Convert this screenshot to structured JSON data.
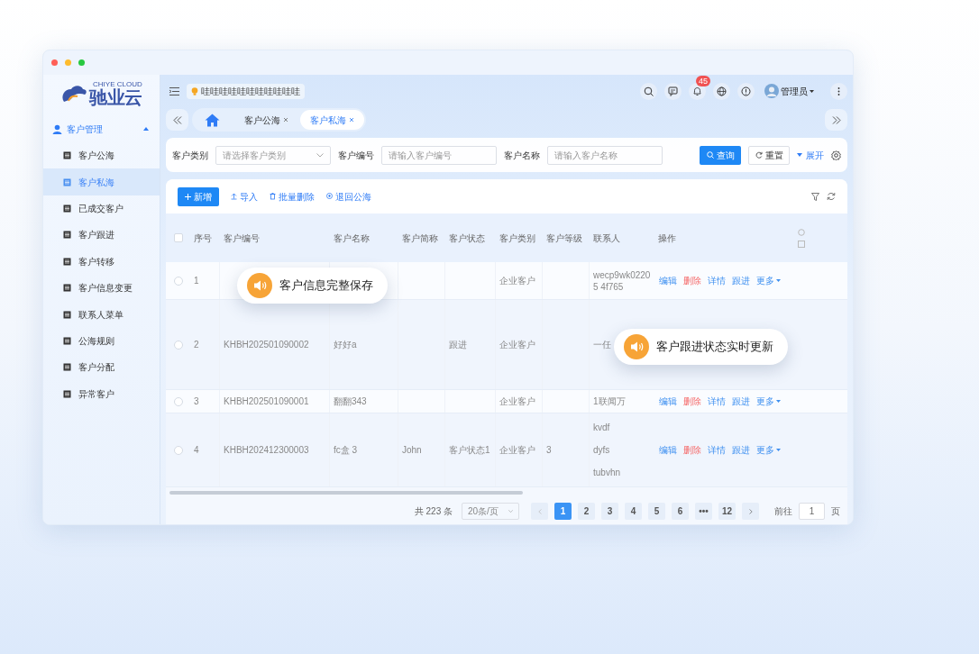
{
  "sidebar": {
    "logo": "驰业云",
    "logo_sub": "CHIYE CLOUD",
    "group": {
      "label": "客户管理",
      "expanded": true,
      "items": [
        {
          "label": "客户公海",
          "selected": false
        },
        {
          "label": "客户私海",
          "selected": true
        },
        {
          "label": "已成交客户",
          "selected": false
        },
        {
          "label": "客户跟进",
          "selected": false
        },
        {
          "label": "客户转移",
          "selected": false
        },
        {
          "label": "客户信息变更",
          "selected": false
        },
        {
          "label": "联系人菜单",
          "selected": false
        },
        {
          "label": "公海规则",
          "selected": false
        },
        {
          "label": "客户分配",
          "selected": false
        },
        {
          "label": "异常客户",
          "selected": false
        }
      ]
    }
  },
  "header": {
    "notice": "哇哇哇哇哇哇哇哇哇哇哇",
    "badge": "45",
    "user": "管理员"
  },
  "tabs": [
    {
      "label": "客户公海",
      "selected": false
    },
    {
      "label": "客户私海",
      "selected": true
    }
  ],
  "filters": [
    {
      "label": "客户类别",
      "kind": "select",
      "placeholder": "请选择客户类别"
    },
    {
      "label": "客户编号",
      "kind": "input",
      "placeholder": "请输入客户编号"
    },
    {
      "label": "客户名称",
      "kind": "input",
      "placeholder": "请输入客户名称"
    }
  ],
  "filter_buttons": {
    "query": "查询",
    "reset": "重置",
    "expand": "展开"
  },
  "toolbar": {
    "add": "新增",
    "actions": [
      "导入",
      "批量删除",
      "退回公海"
    ]
  },
  "table": {
    "all_checked": false,
    "columns": [
      "序号",
      "客户编号",
      "客户名称",
      "客户简称",
      "客户状态",
      "客户类别",
      "客户等级",
      "联系人",
      "操作"
    ],
    "rows": [
      {
        "checked": false,
        "cells": [
          "1",
          "",
          "",
          "",
          "",
          "企业客户",
          ""
        ],
        "contacts": [
          "wecp9wk02205 4f765"
        ],
        "actions": [
          {
            "label": "编辑",
            "kind": "link"
          },
          {
            "label": "删除",
            "kind": "danger"
          },
          {
            "label": "详情",
            "kind": "link"
          },
          {
            "label": "跟进",
            "kind": "link"
          },
          {
            "label": "更多",
            "kind": "more"
          }
        ]
      },
      {
        "checked": false,
        "cells": [
          "2",
          "KHBH202501090002",
          "好好a",
          "",
          "跟进",
          "企业客户",
          ""
        ],
        "contacts": [
          "一任"
        ],
        "actions": []
      },
      {
        "checked": false,
        "cells": [
          "3",
          "KHBH202501090001",
          "翻翻343",
          "",
          "",
          "企业客户",
          ""
        ],
        "contacts": [
          "1联闻万"
        ],
        "actions": [
          {
            "label": "编辑",
            "kind": "link"
          },
          {
            "label": "删除",
            "kind": "danger"
          },
          {
            "label": "详情",
            "kind": "link"
          },
          {
            "label": "跟进",
            "kind": "link"
          },
          {
            "label": "更多",
            "kind": "more"
          }
        ]
      },
      {
        "checked": false,
        "cells": [
          "4",
          "KHBH202412300003",
          "fc盒 3",
          "John",
          "客户状态1",
          "企业客户",
          "3"
        ],
        "contacts": [
          "kvdf",
          "dyfs",
          "tubvhn"
        ],
        "actions": [
          {
            "label": "编辑",
            "kind": "link"
          },
          {
            "label": "删除",
            "kind": "danger"
          },
          {
            "label": "详情",
            "kind": "link"
          },
          {
            "label": "跟进",
            "kind": "link"
          },
          {
            "label": "更多",
            "kind": "more"
          }
        ]
      }
    ]
  },
  "pagination": {
    "total": "共 223 条",
    "size": "20条/页",
    "pages": [
      {
        "label": "1",
        "selected": true
      },
      {
        "label": "2",
        "selected": false
      },
      {
        "label": "3",
        "selected": false
      },
      {
        "label": "4",
        "selected": false
      },
      {
        "label": "5",
        "selected": false
      },
      {
        "label": "6",
        "selected": false
      },
      {
        "label": "•••",
        "selected": false
      },
      {
        "label": "12",
        "selected": false
      }
    ],
    "goto": "前往",
    "goto_value": "1",
    "unit": "页"
  },
  "callouts": [
    {
      "text": "客户信息完整保存"
    },
    {
      "text": "客户跟进状态实时更新"
    }
  ]
}
